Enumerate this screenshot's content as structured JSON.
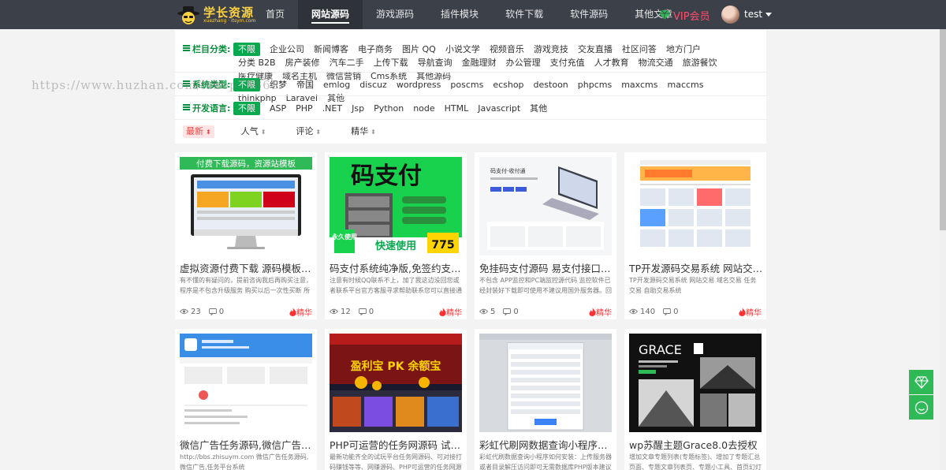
{
  "brand": {
    "name": "学长资源",
    "sub": "xuezhang · itsym.com"
  },
  "nav": [
    {
      "label": "首页"
    },
    {
      "label": "网站源码",
      "active": true
    },
    {
      "label": "游戏源码"
    },
    {
      "label": "插件模块"
    },
    {
      "label": "软件下载"
    },
    {
      "label": "软件源码"
    },
    {
      "label": "其他文章"
    }
  ],
  "vip": {
    "label": "VIP会员",
    "color": "#ff4d6d"
  },
  "user": {
    "name": "test"
  },
  "watermark": "https://www.huzhan.com/ishop55865",
  "filters": {
    "category": {
      "label": "栏目分类:",
      "options": [
        "不限",
        "企业公司",
        "新闻博客",
        "电子商务",
        "图片 QQ",
        "小说文学",
        "视频音乐",
        "游戏竞技",
        "交友直播",
        "社区问答",
        "地方门户",
        "分类 B2B",
        "房产装修",
        "汽车二手",
        "上传下载",
        "导航查询",
        "金融理财",
        "办公管理",
        "支付充值",
        "人才教育",
        "物流交通",
        "旅游餐饮",
        "医疗健康",
        "域名主机",
        "微信营销",
        "Cms系统",
        "其他源码"
      ]
    },
    "system": {
      "label": "系统类型:",
      "options": [
        "不限",
        "织梦",
        "帝国",
        "emlog",
        "discuz",
        "wordpress",
        "poscms",
        "ecshop",
        "destoon",
        "phpcms",
        "maxcms",
        "maccms",
        "thinkphp",
        "Laravel",
        "其他"
      ]
    },
    "language": {
      "label": "开发语言:",
      "options": [
        "不限",
        "ASP",
        "PHP",
        ".NET",
        "Jsp",
        "Python",
        "node",
        "HTML",
        "Javascript",
        "其他"
      ]
    }
  },
  "sort": [
    {
      "label": "最新",
      "on": true
    },
    {
      "label": "人气"
    },
    {
      "label": "评论"
    },
    {
      "label": "精华"
    }
  ],
  "cards": [
    {
      "title": "虚拟资源付费下载 源码模板+网...",
      "desc": "有不懂的有疑问的，提前咨询我后再购买注意，程序是不包含升级服务 购买以后一次性买断 所有功",
      "views": "23",
      "comments": "0",
      "badge": "精华",
      "banner": "付费下载源码，资源站模板",
      "thumb": "imac"
    },
    {
      "title": "码支付系统纯净版,免签约支付,...",
      "desc": "注意有时候QQ联系不上，加了我这边没回您或者联系平台官方客服寻求帮助联系您可以直接通过",
      "views": "12",
      "comments": "0",
      "badge": "精华",
      "banner": "码支付",
      "tag1": "永久使用",
      "tag2": "快速使用",
      "price": "775",
      "thumb": "pay"
    },
    {
      "title": "免挂码支付源码 易支付接口 免...",
      "desc": "不包含 APP监控和PC端监控源代码 监控软件已经封装好下载即可使用不建议用国外服务器。回调慢",
      "views": "5",
      "comments": "0",
      "badge": "精华",
      "banner": "码支付-收付通",
      "thumb": "laptop"
    },
    {
      "title": "TP开发源码交易系统 网站交易 ...",
      "desc": "TP开发源码交易系统 网站交易 域名交易 任务交易 自助交易系统",
      "views": "140",
      "comments": "0",
      "badge": "精华",
      "thumb": "site"
    },
    {
      "title": "微信广告任务源码,微信广告,任...",
      "desc": "http://bbs.zhisuym.com 微信广告任务源码,微信广告,任务平台系统",
      "thumb": "wechat"
    },
    {
      "title": "PHP可运营的任务网源码 试玩...",
      "desc": "最新功能齐全的试玩平台任务网源码、可对接打码赚钱等等、网赚源码、PHP可运营的任务网源码、",
      "banner": "盈利宝 PK 余额宝",
      "thumb": "game"
    },
    {
      "title": "彩虹代刷网数据查询小程序源码...",
      "desc": "彩虹代刷数据查询小程序如何安装：上传服务器或者目录解压访问即可无需数据库PHP版本建议设置",
      "thumb": "table"
    },
    {
      "title": "wp苏醒主题Grace8.0去授权",
      "desc": "增加文章专题列表(专题标签)、增加了专题汇总页面、专题文章列表页、专题小工具、首页幻灯片下",
      "banner": "GRACE",
      "thumb": "grace"
    }
  ]
}
